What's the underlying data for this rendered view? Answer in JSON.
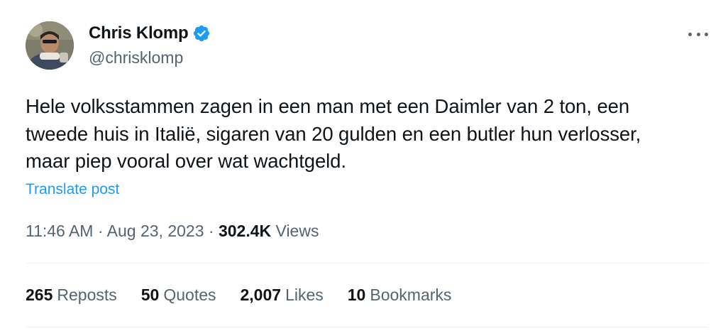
{
  "author": {
    "name": "Chris Klomp",
    "handle": "@chrisklomp"
  },
  "tweet": {
    "lines": [
      "Hele volksstammen zagen in een man met een Daimler van 2 ton, een",
      "tweede huis in Italië, sigaren van 20 gulden en een butler hun verlosser,",
      "maar piep vooral over wat wachtgeld."
    ],
    "translate_label": "Translate post"
  },
  "meta": {
    "time": "11:46 AM",
    "date": "Aug 23, 2023",
    "separator": "·",
    "views_count": "302.4K",
    "views_label": "Views"
  },
  "stats": [
    {
      "count": "265",
      "label": "Reposts"
    },
    {
      "count": "50",
      "label": "Quotes"
    },
    {
      "count": "2,007",
      "label": "Likes"
    },
    {
      "count": "10",
      "label": "Bookmarks"
    }
  ],
  "colors": {
    "accent": "#1d9bf0",
    "text": "#0f1419",
    "muted": "#536471",
    "divider": "#eff3f4"
  }
}
